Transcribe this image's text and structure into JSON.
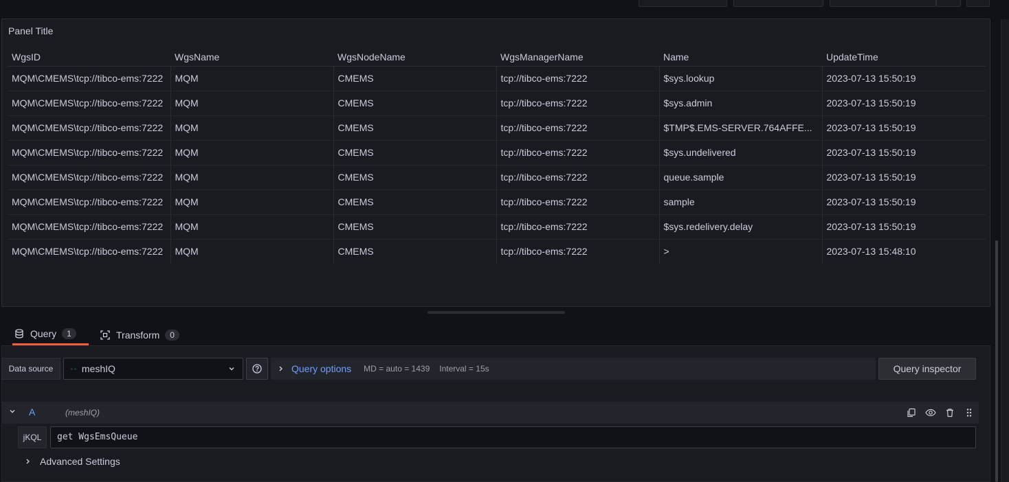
{
  "panel": {
    "title": "Panel Title",
    "columns": [
      "WgsID",
      "WgsName",
      "WgsNodeName",
      "WgsManagerName",
      "Name",
      "UpdateTime"
    ],
    "rows": [
      [
        "MQM\\CMEMS\\tcp://tibco-ems:7222",
        "MQM",
        "CMEMS",
        "tcp://tibco-ems:7222",
        "$sys.lookup",
        "2023-07-13 15:50:19"
      ],
      [
        "MQM\\CMEMS\\tcp://tibco-ems:7222",
        "MQM",
        "CMEMS",
        "tcp://tibco-ems:7222",
        "$sys.admin",
        "2023-07-13 15:50:19"
      ],
      [
        "MQM\\CMEMS\\tcp://tibco-ems:7222",
        "MQM",
        "CMEMS",
        "tcp://tibco-ems:7222",
        "$TMP$.EMS-SERVER.764AFFE...",
        "2023-07-13 15:50:19"
      ],
      [
        "MQM\\CMEMS\\tcp://tibco-ems:7222",
        "MQM",
        "CMEMS",
        "tcp://tibco-ems:7222",
        "$sys.undelivered",
        "2023-07-13 15:50:19"
      ],
      [
        "MQM\\CMEMS\\tcp://tibco-ems:7222",
        "MQM",
        "CMEMS",
        "tcp://tibco-ems:7222",
        "queue.sample",
        "2023-07-13 15:50:19"
      ],
      [
        "MQM\\CMEMS\\tcp://tibco-ems:7222",
        "MQM",
        "CMEMS",
        "tcp://tibco-ems:7222",
        "sample",
        "2023-07-13 15:50:19"
      ],
      [
        "MQM\\CMEMS\\tcp://tibco-ems:7222",
        "MQM",
        "CMEMS",
        "tcp://tibco-ems:7222",
        "$sys.redelivery.delay",
        "2023-07-13 15:50:19"
      ],
      [
        "MQM\\CMEMS\\tcp://tibco-ems:7222",
        "MQM",
        "CMEMS",
        "tcp://tibco-ems:7222",
        ">",
        "2023-07-13 15:48:10"
      ]
    ]
  },
  "tabs": [
    {
      "label": "Query",
      "count": "1",
      "icon": "database-icon",
      "active": true
    },
    {
      "label": "Transform",
      "count": "0",
      "icon": "transform-icon",
      "active": false
    }
  ],
  "datasource": {
    "label": "Data source",
    "selected": "meshIQ",
    "query_options_label": "Query options",
    "md": "MD = auto = 1439",
    "interval": "Interval = 15s",
    "inspector_label": "Query inspector"
  },
  "query": {
    "ref_id": "A",
    "datasource_name": "(meshIQ)",
    "field_label": "jKQL",
    "value": "get WgsEmsQueue",
    "advanced_label": "Advanced Settings"
  },
  "colors": {
    "accent_tab": "#f55f3e",
    "link": "#6e9fff",
    "background": "#111217",
    "panel": "#181b1f"
  }
}
